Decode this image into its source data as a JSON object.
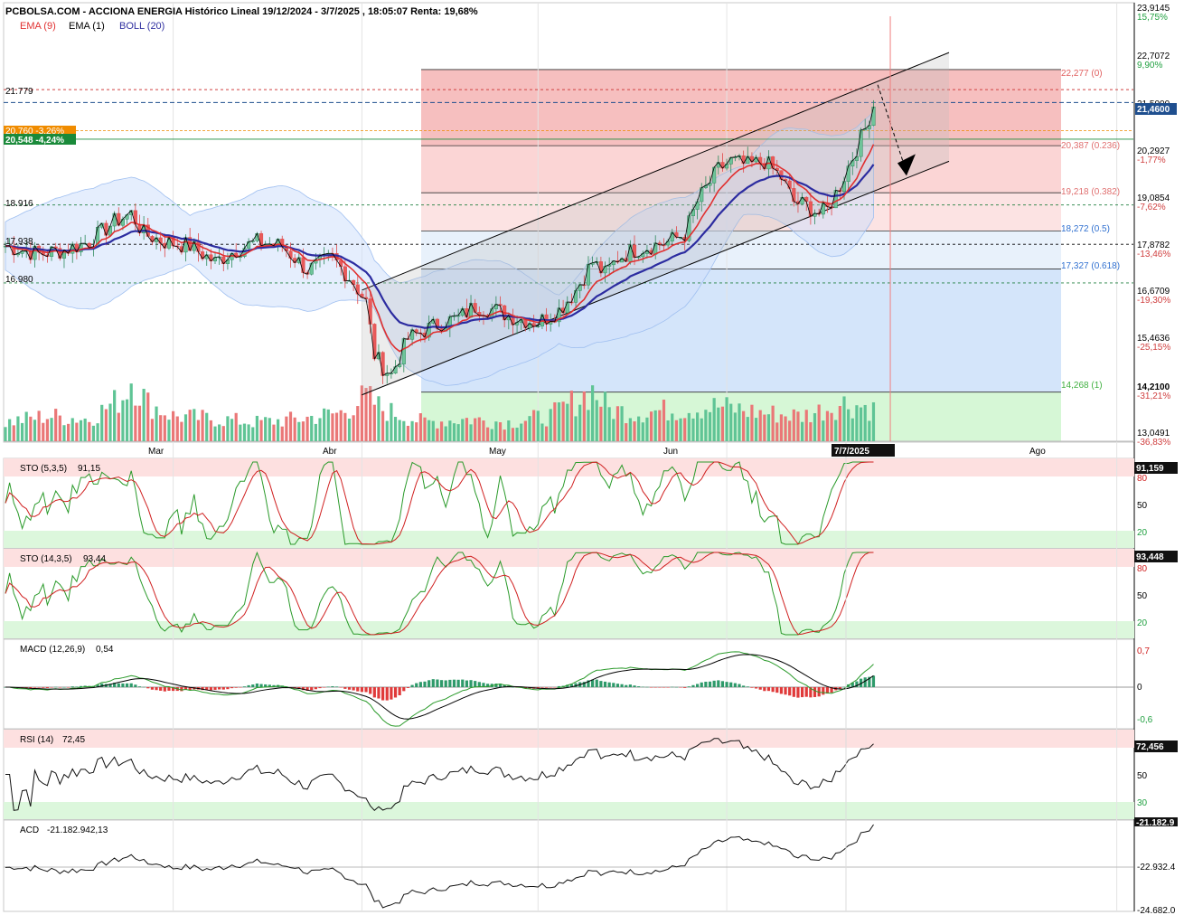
{
  "header": {
    "title": "PCBOLSA.COM - ACCIONA ENERGIA Histórico Lineal 19/12/2024 - 3/7/2025 , 18:05:07 Renta: 19,68%",
    "legend": [
      {
        "label": "EMA (9)",
        "color": "#e03030"
      },
      {
        "label": "EMA (1)",
        "color": "#000000"
      },
      {
        "label": "BOLL (20)",
        "color": "#3030a0"
      }
    ]
  },
  "price_axis": {
    "ticks": [
      {
        "value": 23.9145,
        "label": "23,9145",
        "pct": "15,75%"
      },
      {
        "value": 22.7072,
        "label": "22,7072",
        "pct": "9,90%"
      },
      {
        "value": 21.5,
        "label": "21,5000",
        "pct": ""
      },
      {
        "value": 20.2927,
        "label": "20,2927",
        "pct": "-1,77%"
      },
      {
        "value": 19.0854,
        "label": "19,0854",
        "pct": "-7,62%"
      },
      {
        "value": 17.8782,
        "label": "17,8782",
        "pct": "-13,46%"
      },
      {
        "value": 16.6709,
        "label": "16,6709",
        "pct": "-19,30%"
      },
      {
        "value": 15.4636,
        "label": "15,4636",
        "pct": "-25,15%"
      },
      {
        "value": 14.21,
        "label": "14,2100",
        "pct": "-31,21%"
      },
      {
        "value": 13.0491,
        "label": "13,0491",
        "pct": "-36,83%"
      }
    ],
    "current_value_label": "21,4600",
    "current_value": 21.46
  },
  "left_levels": [
    {
      "label": "21.779",
      "value": 21.779,
      "color": "#d04040"
    },
    {
      "label": "18.916",
      "value": 18.916,
      "color": "#208040"
    },
    {
      "label": "17.938",
      "value": 17.938,
      "color": "#000000"
    },
    {
      "label": "16.980",
      "value": 16.98,
      "color": "#208040"
    }
  ],
  "left_badges": [
    {
      "label": "20,760 -3,26%",
      "value": 20.76,
      "color": "#f08c00"
    },
    {
      "label": "20,548 -4,24%",
      "value": 20.548,
      "color": "#1a8a3a"
    }
  ],
  "fibonacci": [
    {
      "label": "22,277 (0)",
      "value": 22.277,
      "color": "#e06060"
    },
    {
      "label": "20,387 (0.236)",
      "value": 20.387,
      "color": "#e07070"
    },
    {
      "label": "19,218 (0.382)",
      "value": 19.218,
      "color": "#e07070"
    },
    {
      "label": "18,272 (0.5)",
      "value": 18.272,
      "color": "#3070d0"
    },
    {
      "label": "17,327 (0.618)",
      "value": 17.327,
      "color": "#3070d0"
    },
    {
      "label": "14,268 (1)",
      "value": 14.268,
      "color": "#40b040"
    }
  ],
  "time_axis": {
    "months": [
      {
        "label": "Mar",
        "index": 40
      },
      {
        "label": "Abr",
        "index": 85
      },
      {
        "label": "May",
        "index": 127
      },
      {
        "label": "Jun",
        "index": 172
      },
      {
        "label": "Ago",
        "index": 265
      }
    ],
    "cursor_date": "7/7/2025"
  },
  "indicators": {
    "sto1": {
      "title": "STO (5,3,5)",
      "value_text": "91,15",
      "badge": "91,159",
      "levels": [
        "80",
        "50",
        "20"
      ]
    },
    "sto2": {
      "title": "STO (14,3,5)",
      "value_text": "93,44",
      "badge": "93,448",
      "levels": [
        "80",
        "50",
        "20"
      ]
    },
    "macd": {
      "title": "MACD (12,26,9)",
      "value_text": "0,54",
      "levels": [
        "0,7",
        "0",
        "-0,6"
      ]
    },
    "rsi": {
      "title": "RSI (14)",
      "value_text": "72,45",
      "badge": "72,456",
      "levels": [
        "50",
        "30"
      ]
    },
    "acd": {
      "title": "ACD",
      "value_text": "-21.182.942,13",
      "badge": "-21.182.9",
      "levels": [
        "-22.932.4",
        "-24.682.0"
      ]
    }
  },
  "chart_data": {
    "type": "candlestick",
    "title": "PCBOLSA.COM - ACCIONA ENERGIA Histórico Lineal 19/12/2024 - 3/7/2025 , 18:05:07 Renta: 19,68%",
    "x_start": "2025-02-03",
    "x_end": "2025-07-03",
    "ylim": [
      13.0491,
      23.9145
    ],
    "close_anchors": [
      [
        0,
        17.9
      ],
      [
        8,
        17.7
      ],
      [
        14,
        17.8
      ],
      [
        20,
        18.0
      ],
      [
        26,
        18.5
      ],
      [
        30,
        18.7
      ],
      [
        33,
        18.2
      ],
      [
        38,
        18.0
      ],
      [
        44,
        17.9
      ],
      [
        50,
        17.5
      ],
      [
        55,
        17.8
      ],
      [
        60,
        18.0
      ],
      [
        66,
        17.9
      ],
      [
        72,
        17.3
      ],
      [
        78,
        17.6
      ],
      [
        83,
        17.0
      ],
      [
        86,
        16.5
      ],
      [
        88,
        15.2
      ],
      [
        90,
        14.9
      ],
      [
        92,
        14.7
      ],
      [
        96,
        15.6
      ],
      [
        100,
        15.8
      ],
      [
        104,
        16.0
      ],
      [
        108,
        16.1
      ],
      [
        112,
        16.4
      ],
      [
        117,
        16.3
      ],
      [
        122,
        16.1
      ],
      [
        127,
        16.0
      ],
      [
        132,
        16.3
      ],
      [
        136,
        16.8
      ],
      [
        140,
        17.5
      ],
      [
        143,
        17.2
      ],
      [
        146,
        17.6
      ],
      [
        150,
        17.8
      ],
      [
        154,
        17.9
      ],
      [
        158,
        18.0
      ],
      [
        162,
        18.2
      ],
      [
        165,
        19.0
      ],
      [
        170,
        19.8
      ],
      [
        173,
        20.0
      ],
      [
        177,
        19.9
      ],
      [
        181,
        20.0
      ],
      [
        185,
        19.6
      ],
      [
        188,
        19.0
      ],
      [
        191,
        18.9
      ],
      [
        194,
        18.7
      ],
      [
        196,
        18.8
      ],
      [
        199,
        19.4
      ],
      [
        202,
        20.1
      ],
      [
        205,
        20.8
      ],
      [
        207,
        21.4
      ]
    ],
    "volume_anchors": [
      [
        0,
        0.3
      ],
      [
        10,
        0.4
      ],
      [
        20,
        0.35
      ],
      [
        28,
        0.7
      ],
      [
        30,
        1.0
      ],
      [
        34,
        0.6
      ],
      [
        40,
        0.4
      ],
      [
        50,
        0.35
      ],
      [
        60,
        0.3
      ],
      [
        70,
        0.35
      ],
      [
        80,
        0.45
      ],
      [
        86,
        0.7
      ],
      [
        90,
        0.5
      ],
      [
        100,
        0.3
      ],
      [
        110,
        0.35
      ],
      [
        120,
        0.3
      ],
      [
        130,
        0.4
      ],
      [
        140,
        0.8
      ],
      [
        144,
        0.5
      ],
      [
        150,
        0.45
      ],
      [
        160,
        0.5
      ],
      [
        170,
        0.55
      ],
      [
        180,
        0.45
      ],
      [
        190,
        0.4
      ],
      [
        200,
        0.6
      ],
      [
        205,
        0.55
      ],
      [
        207,
        0.5
      ]
    ],
    "channel_lines": [
      {
        "from": [
          85,
          16.8
        ],
        "to": [
          225,
          22.7
        ]
      },
      {
        "from": [
          85,
          14.2
        ],
        "to": [
          225,
          20.0
        ]
      }
    ],
    "projection_arrow": {
      "from": [
        208,
        21.9
      ],
      "to": [
        214,
        20.0
      ]
    },
    "date_range_marker": {
      "index": 211
    }
  }
}
